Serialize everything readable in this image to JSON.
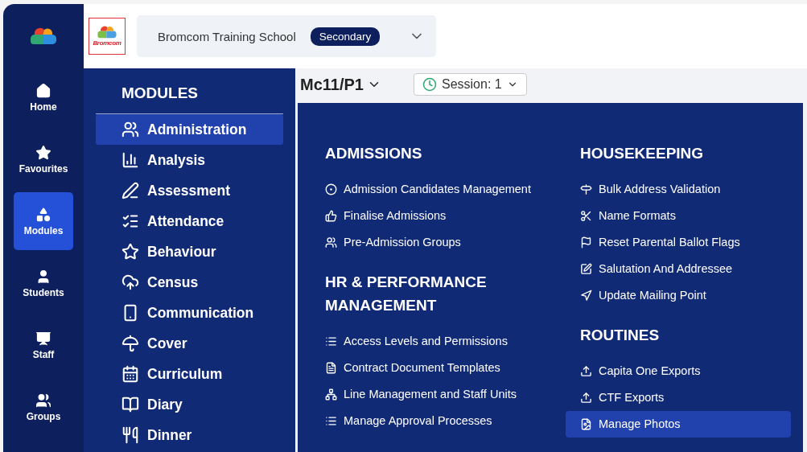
{
  "logo_text": "Bromcom",
  "school": {
    "name": "Bromcom Training School",
    "badge": "Secondary"
  },
  "rail": [
    {
      "label": "Home",
      "selected": false
    },
    {
      "label": "Favourites",
      "selected": false
    },
    {
      "label": "Modules",
      "selected": true
    },
    {
      "label": "Students",
      "selected": false
    },
    {
      "label": "Staff",
      "selected": false
    },
    {
      "label": "Groups",
      "selected": false
    }
  ],
  "background": {
    "class_name": "Mc11/P1",
    "session": "Session: 1"
  },
  "modules": {
    "title": "MODULES",
    "items": [
      {
        "label": "Administration",
        "selected": true
      },
      {
        "label": "Analysis",
        "selected": false
      },
      {
        "label": "Assessment",
        "selected": false
      },
      {
        "label": "Attendance",
        "selected": false
      },
      {
        "label": "Behaviour",
        "selected": false
      },
      {
        "label": "Census",
        "selected": false
      },
      {
        "label": "Communication",
        "selected": false
      },
      {
        "label": "Cover",
        "selected": false
      },
      {
        "label": "Curriculum",
        "selected": false
      },
      {
        "label": "Diary",
        "selected": false
      },
      {
        "label": "Dinner",
        "selected": false
      }
    ]
  },
  "menu": {
    "columns": [
      [
        {
          "title": "ADMISSIONS",
          "items": [
            {
              "label": "Admission Candidates Management",
              "selected": false
            },
            {
              "label": "Finalise Admissions",
              "selected": false
            },
            {
              "label": "Pre-Admission Groups",
              "selected": false
            }
          ]
        },
        {
          "title": "HR & PERFORMANCE MANAGEMENT",
          "items": [
            {
              "label": "Access Levels and Permissions",
              "selected": false
            },
            {
              "label": "Contract Document Templates",
              "selected": false
            },
            {
              "label": "Line Management and Staff Units",
              "selected": false
            },
            {
              "label": "Manage Approval Processes",
              "selected": false
            }
          ]
        }
      ],
      [
        {
          "title": "HOUSEKEEPING",
          "items": [
            {
              "label": "Bulk Address Validation",
              "selected": false
            },
            {
              "label": "Name Formats",
              "selected": false
            },
            {
              "label": "Reset Parental Ballot Flags",
              "selected": false
            },
            {
              "label": "Salutation And Addressee",
              "selected": false
            },
            {
              "label": "Update Mailing Point",
              "selected": false
            }
          ]
        },
        {
          "title": "ROUTINES",
          "items": [
            {
              "label": "Capita One Exports",
              "selected": false
            },
            {
              "label": "CTF Exports",
              "selected": false
            },
            {
              "label": "Manage Photos",
              "selected": true
            }
          ]
        }
      ]
    ]
  }
}
